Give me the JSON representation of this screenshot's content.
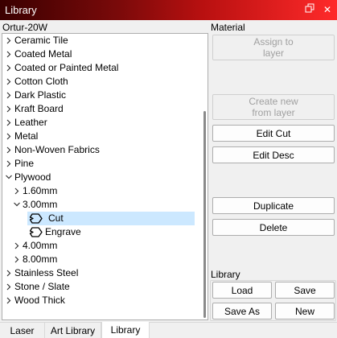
{
  "window": {
    "title": "Library"
  },
  "device": "Ortur-20W",
  "material_header": "Material",
  "tree": [
    {
      "label": "Ceramic Tile",
      "state": "collapsed"
    },
    {
      "label": "Coated Metal",
      "state": "collapsed"
    },
    {
      "label": "Coated or Painted Metal",
      "state": "collapsed"
    },
    {
      "label": "Cotton Cloth",
      "state": "collapsed"
    },
    {
      "label": "Dark Plastic",
      "state": "collapsed"
    },
    {
      "label": "Kraft Board",
      "state": "collapsed"
    },
    {
      "label": "Leather",
      "state": "collapsed"
    },
    {
      "label": "Metal",
      "state": "collapsed"
    },
    {
      "label": "Non-Woven Fabrics",
      "state": "collapsed"
    },
    {
      "label": "Pine",
      "state": "collapsed"
    },
    {
      "label": "Plywood",
      "state": "expanded"
    },
    {
      "label": "1.60mm",
      "state": "collapsed"
    },
    {
      "label": "3.00mm",
      "state": "expanded"
    },
    {
      "label": "Cut",
      "state": "leaf-selected"
    },
    {
      "label": "Engrave",
      "state": "leaf"
    },
    {
      "label": "4.00mm",
      "state": "collapsed"
    },
    {
      "label": "8.00mm",
      "state": "collapsed"
    },
    {
      "label": "Stainless Steel",
      "state": "collapsed"
    },
    {
      "label": "Stone / Slate",
      "state": "collapsed"
    },
    {
      "label": "Wood Thick",
      "state": "collapsed"
    }
  ],
  "buttons": {
    "assign": "Assign to\nlayer",
    "create": "Create new\nfrom layer",
    "edit_cut": "Edit Cut",
    "edit_desc": "Edit Desc",
    "duplicate": "Duplicate",
    "delete": "Delete"
  },
  "library_group": {
    "title": "Library",
    "load": "Load",
    "save": "Save",
    "save_as": "Save As",
    "new": "New"
  },
  "tabs": [
    "Laser",
    "Art Library",
    "Library"
  ],
  "active_tab": "Library",
  "colors": {
    "titlebar_start": "#3a0000",
    "titlebar_end": "#ff2a2a",
    "selection": "#cce8ff"
  }
}
